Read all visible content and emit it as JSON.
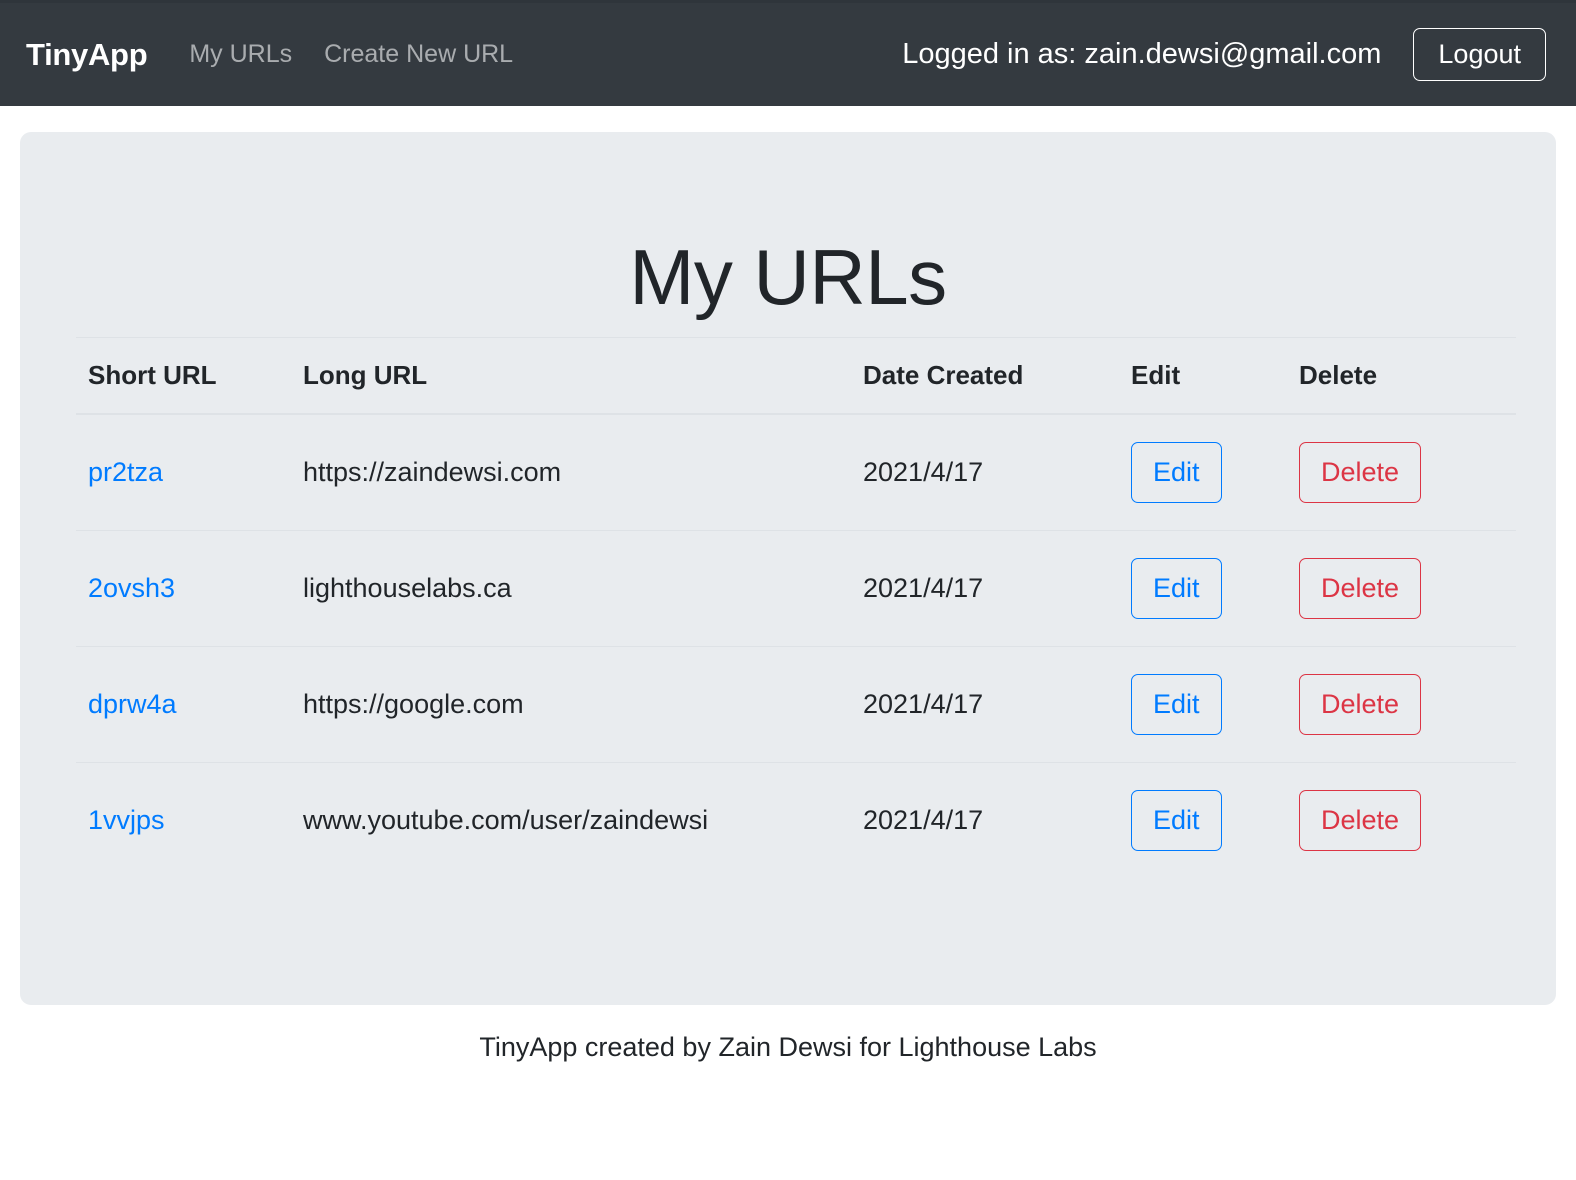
{
  "navbar": {
    "brand": "TinyApp",
    "links": [
      {
        "label": "My URLs"
      },
      {
        "label": "Create New URL"
      }
    ],
    "logged_in_text": "Logged in as: zain.dewsi@gmail.com",
    "logout_label": "Logout",
    "background_color": "#343a40",
    "brand_color": "#ffffff",
    "link_color": "#9ba0a6"
  },
  "main": {
    "title": "My URLs",
    "card_background": "#e9ecef",
    "table": {
      "headers": [
        "Short URL",
        "Long URL",
        "Date Created",
        "Edit",
        "Delete"
      ],
      "rows": [
        {
          "short_url": "pr2tza",
          "long_url": "https://zaindewsi.com",
          "date_created": "2021/4/17",
          "edit_label": "Edit",
          "delete_label": "Delete"
        },
        {
          "short_url": "2ovsh3",
          "long_url": "lighthouselabs.ca",
          "date_created": "2021/4/17",
          "edit_label": "Edit",
          "delete_label": "Delete"
        },
        {
          "short_url": "dprw4a",
          "long_url": "https://google.com",
          "date_created": "2021/4/17",
          "edit_label": "Edit",
          "delete_label": "Delete"
        },
        {
          "short_url": "1vvjps",
          "long_url": "www.youtube.com/user/zaindewsi",
          "date_created": "2021/4/17",
          "edit_label": "Edit",
          "delete_label": "Delete"
        }
      ]
    },
    "link_color": "#007bff",
    "delete_color": "#dc3545"
  },
  "footer": {
    "text": "TinyApp created by Zain Dewsi for Lighthouse Labs"
  }
}
